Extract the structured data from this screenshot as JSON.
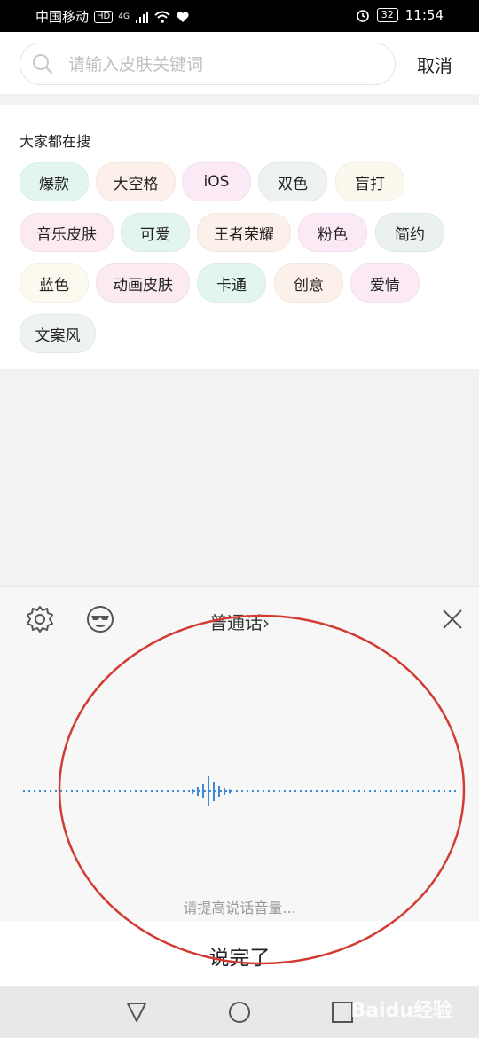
{
  "status_bar": {
    "carrier": "中国移动",
    "hd_badge": "HD",
    "network": "4G",
    "battery": "32",
    "time": "11:54"
  },
  "search": {
    "placeholder": "请输入皮肤关键词",
    "value": "",
    "cancel_label": "取消"
  },
  "hot_search": {
    "title": "大家都在搜",
    "tags": [
      {
        "label": "爆款",
        "color": "#e3f6ee"
      },
      {
        "label": "大空格",
        "color": "#fdf0ea"
      },
      {
        "label": "iOS",
        "color": "#fbe9f5"
      },
      {
        "label": "双色",
        "color": "#eef2f0"
      },
      {
        "label": "盲打",
        "color": "#fcf8ee"
      },
      {
        "label": "音乐皮肤",
        "color": "#fbeaf0"
      },
      {
        "label": "可爱",
        "color": "#e3f6ee"
      },
      {
        "label": "王者荣耀",
        "color": "#fcf1ea"
      },
      {
        "label": "粉色",
        "color": "#fbe9f5"
      },
      {
        "label": "简约",
        "color": "#eaf1ef"
      },
      {
        "label": "蓝色",
        "color": "#fcf9ee"
      },
      {
        "label": "动画皮肤",
        "color": "#fbeaf0"
      },
      {
        "label": "卡通",
        "color": "#e3f6ee"
      },
      {
        "label": "创意",
        "color": "#fcf1ea"
      },
      {
        "label": "爱情",
        "color": "#fbe9f5"
      },
      {
        "label": "文案风",
        "color": "#eef2f0"
      }
    ]
  },
  "voice": {
    "language_label": "普通话›",
    "hint": "请提高说话音量...",
    "done_label": "说完了",
    "accent_color": "#3a8ad6"
  },
  "navbar": {
    "watermark": "Baidu经验"
  },
  "annotation_color": "#d23a32"
}
